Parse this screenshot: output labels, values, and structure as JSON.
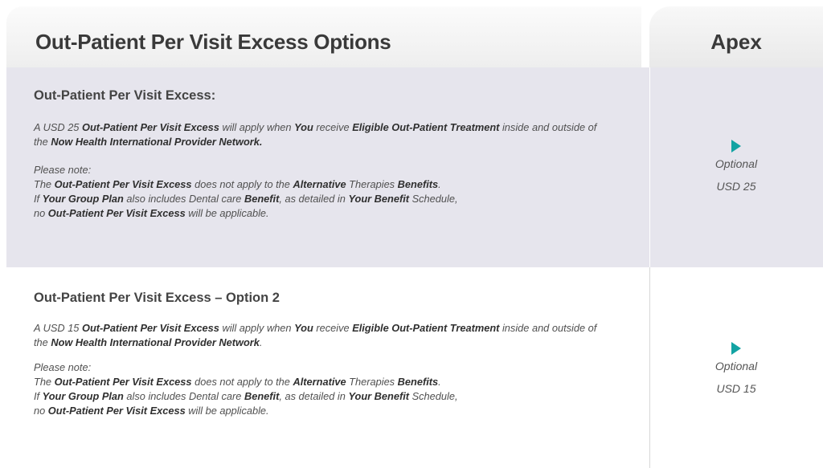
{
  "header": {
    "title": "Out-Patient Per Visit Excess Options",
    "apex": "Apex"
  },
  "rows": [
    {
      "title": "Out-Patient Per Visit Excess:",
      "para1": [
        "A USD 25 ",
        "Out-Patient Per Visit Excess",
        " will apply when ",
        "You",
        " receive ",
        "Eligible Out-Patient Treatment",
        " inside and outside of the ",
        "Now Health International Provider Network."
      ],
      "note_label": "Please note:",
      "note_line1": [
        "The ",
        "Out-Patient Per Visit Excess",
        " does not apply to the ",
        "Alternative",
        " Therapies ",
        "Benefits",
        "."
      ],
      "note_line2": [
        "If ",
        "Your Group Plan",
        " also includes Dental care ",
        "Benefit",
        ", as detailed in ",
        "Your Benefit",
        " Schedule,"
      ],
      "note_line3": [
        "no ",
        "Out-Patient Per Visit Excess",
        " will be applicable."
      ],
      "option_label": "Optional",
      "option_value": "USD 25",
      "option_icon": "play-triangle-icon"
    },
    {
      "title": "Out-Patient Per Visit Excess – Option 2",
      "para1": [
        "A USD 15 ",
        "Out-Patient Per Visit Excess",
        " will apply when ",
        "You",
        " receive ",
        "Eligible Out-Patient Treatment",
        " inside and outside of the ",
        "Now Health International Provider Network",
        "."
      ],
      "note_label": "Please note:",
      "note_line1": [
        "The ",
        "Out-Patient Per Visit Excess",
        " does not apply to the ",
        "Alternative",
        " Therapies ",
        "Benefits",
        "."
      ],
      "note_line2": [
        "If ",
        "Your Group Plan",
        " also includes Dental care ",
        "Benefit",
        ", as detailed in ",
        "Your Benefit",
        " Schedule,"
      ],
      "note_line3": [
        "no ",
        "Out-Patient Per Visit Excess",
        " will be applicable."
      ],
      "option_label": "Optional",
      "option_value": "USD 15",
      "option_icon": "play-triangle-icon"
    }
  ],
  "colors": {
    "row_highlight": "#e6e5ed",
    "accent_triangle": "#12a3a3",
    "header_bg": "#eeeeee"
  }
}
